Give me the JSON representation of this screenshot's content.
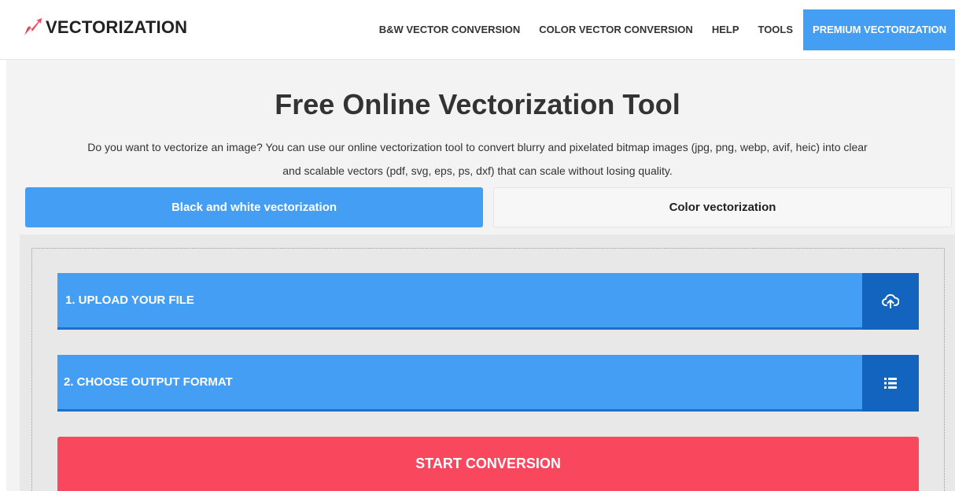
{
  "brand": {
    "name": "VECTORIZATION",
    "accent": "#449ff4",
    "logo_color": "#f9485d"
  },
  "nav": {
    "items": [
      {
        "label": "B&W VECTOR CONVERSION"
      },
      {
        "label": "COLOR VECTOR CONVERSION"
      },
      {
        "label": "HELP"
      },
      {
        "label": "TOOLS"
      },
      {
        "label": "PREMIUM VECTORIZATION"
      }
    ]
  },
  "hero": {
    "title": "Free Online Vectorization Tool",
    "intro_line1": "Do you want to vectorize an image? You can use our online vectorization tool to convert blurry and pixelated bitmap images (jpg, png, webp, avif, heic) into clear",
    "intro_line2": "and scalable vectors (pdf, svg, eps, ps, dxf) that can scale without losing quality."
  },
  "tabs": [
    {
      "label": "Black and white vectorization",
      "active": true
    },
    {
      "label": "Color vectorization",
      "active": false
    }
  ],
  "steps": [
    {
      "label": "1. UPLOAD YOUR FILE",
      "icon": "cloud-upload-icon"
    },
    {
      "label": "2. CHOOSE OUTPUT FORMAT",
      "icon": "list-icon"
    }
  ],
  "actions": {
    "start_label": "START CONVERSION",
    "start_color": "#f9485d"
  }
}
